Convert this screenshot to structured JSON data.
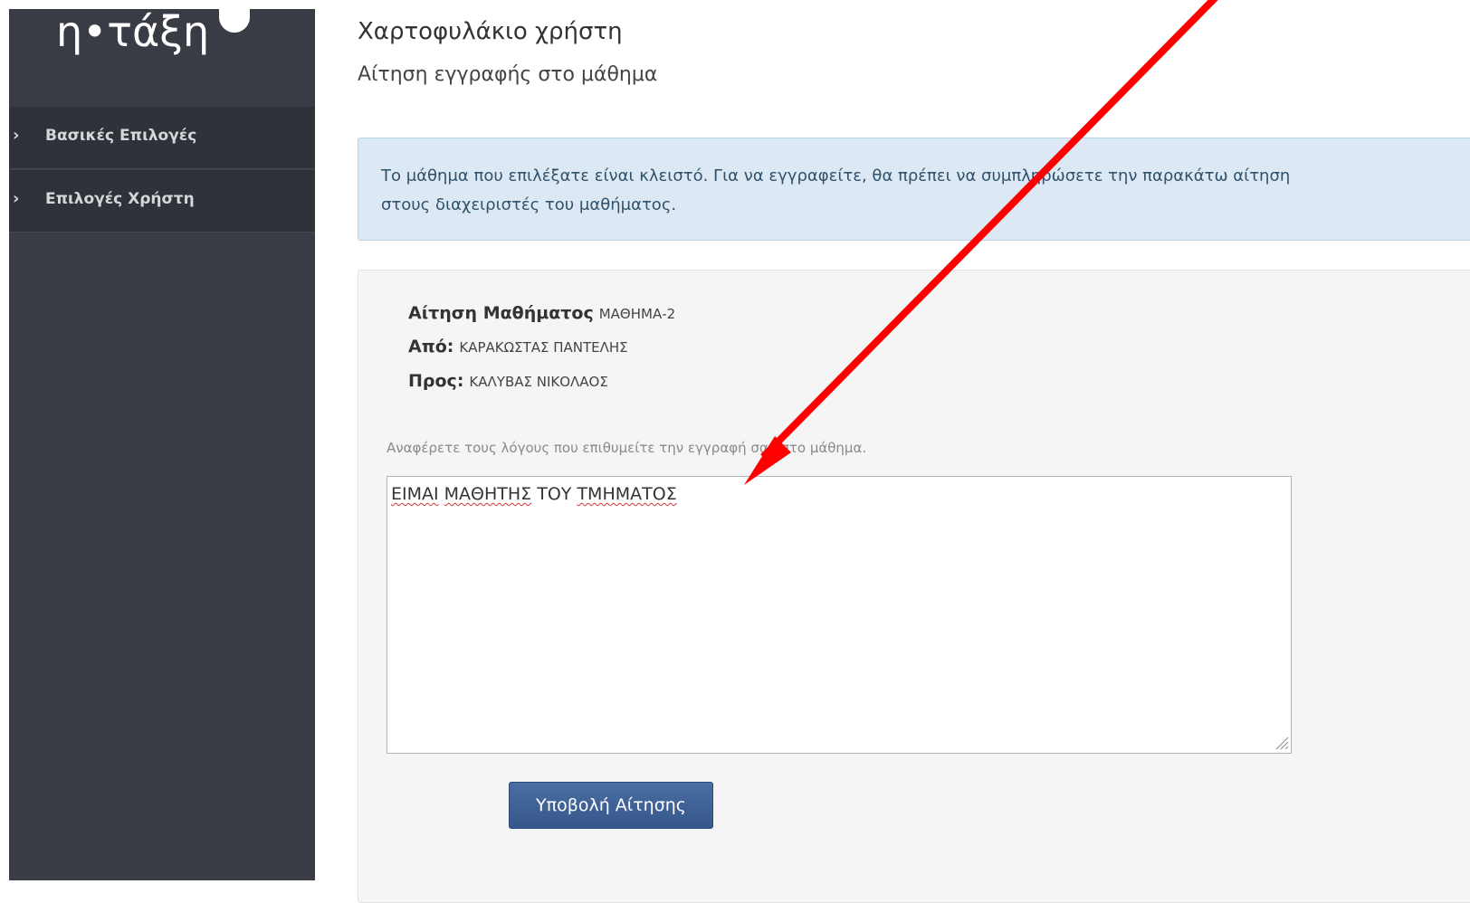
{
  "sidebar": {
    "logo_text": "η•τάξη",
    "items": [
      {
        "label": "Βασικές Επιλογές"
      },
      {
        "label": "Επιλογές Χρήστη"
      }
    ]
  },
  "header": {
    "title": "Χαρτοφυλάκιο χρήστη",
    "subtitle": "Αίτηση εγγραφής στο μάθημα"
  },
  "alert": {
    "line1": "Το μάθημα που επιλέξατε είναι κλειστό. Για να εγγραφείτε, θα πρέπει να συμπληρώσετε την παρακάτω αίτηση",
    "line2": "στους διαχειριστές του μαθήματος."
  },
  "request": {
    "course_key": "Αίτηση Μαθήματος",
    "course_value": "ΜΑΘΗΜΑ-2",
    "from_key": "Από:",
    "from_value": "ΚΑΡΑΚΩΣΤΑΣ ΠΑΝΤΕΛΗΣ",
    "to_key": "Προς:",
    "to_value": "ΚΑΛΥΒΑΣ ΝΙΚΟΛΑΟΣ",
    "hint": "Αναφέρετε τους λόγους που επιθυμείτε την εγγραφή σας στο μάθημα.",
    "reason_words": [
      "ΕΙΜΑΙ",
      "ΜΑΘΗΤΗΣ",
      "ΤΟΥ",
      "ΤΜΗΜΑΤΟΣ"
    ],
    "submit_label": "Υποβολή Αίτησης"
  },
  "annotation": {
    "arrow_color": "#ff0000"
  }
}
